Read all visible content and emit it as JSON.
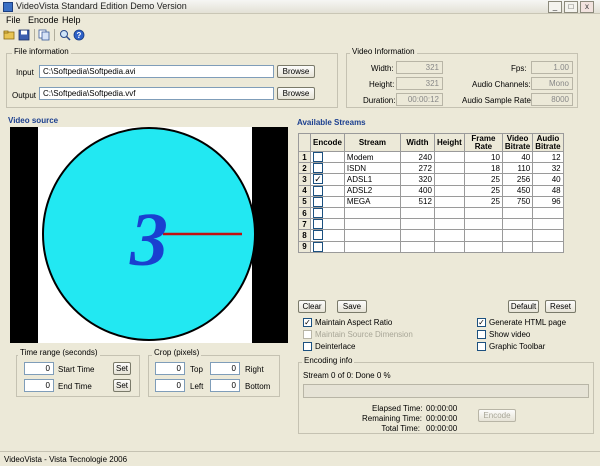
{
  "window": {
    "title": "VideoVista Standard Edition  Demo Version",
    "controls": [
      "_",
      "□",
      "x"
    ]
  },
  "menu": [
    "File",
    "Encode",
    "Help"
  ],
  "toolbar": [
    "open-icon",
    "save-icon",
    "copy-icon",
    "find-icon",
    "help-icon"
  ],
  "file_info": {
    "heading": "File information",
    "input_label": "Input",
    "input_value": "C:\\Softpedia\\Softpedia.avi",
    "output_label": "Output",
    "output_value": "C:\\Softpedia\\Softpedia.vvf",
    "browse_label": "Browse"
  },
  "video_info": {
    "heading": "Video Information",
    "width_label": "Width:",
    "width_value": "321",
    "height_label": "Height:",
    "height_value": "321",
    "duration_label": "Duration:",
    "duration_value": "00:00:12",
    "fps_label": "Fps:",
    "fps_value": "1.00",
    "channels_label": "Audio Channels:",
    "channels_value": "Mono",
    "rate_label": "Audio Sample Rate:",
    "rate_value": "8000"
  },
  "video_source": {
    "heading": "Video source",
    "frame_digit": "3"
  },
  "time_range": {
    "heading": "Time range (seconds)",
    "start_value": "0",
    "start_label": "Start Time",
    "end_value": "0",
    "end_label": "End Time",
    "set_label": "Set"
  },
  "crop": {
    "heading": "Crop (pixels)",
    "top_value": "0",
    "top_label": "Top",
    "right_value": "0",
    "right_label": "Right",
    "left_value": "0",
    "left_label": "Left",
    "bottom_value": "0",
    "bottom_label": "Bottom"
  },
  "streams": {
    "heading": "Available Streams",
    "columns": [
      "Encode",
      "Stream",
      "Width",
      "Height",
      "Frame Rate",
      "Video Bitrate",
      "Audio Bitrate"
    ],
    "rows": [
      {
        "n": "1",
        "encode": "",
        "stream": "Modem",
        "width": "240",
        "height": "",
        "fps": "10",
        "vbr": "40",
        "abr": "12"
      },
      {
        "n": "2",
        "encode": "",
        "stream": "ISDN",
        "width": "272",
        "height": "",
        "fps": "18",
        "vbr": "110",
        "abr": "32"
      },
      {
        "n": "3",
        "encode": "✓",
        "stream": "ADSL1",
        "width": "320",
        "height": "",
        "fps": "25",
        "vbr": "256",
        "abr": "40"
      },
      {
        "n": "4",
        "encode": "",
        "stream": "ADSL2",
        "width": "400",
        "height": "",
        "fps": "25",
        "vbr": "450",
        "abr": "48"
      },
      {
        "n": "5",
        "encode": "",
        "stream": "MEGA",
        "width": "512",
        "height": "",
        "fps": "25",
        "vbr": "750",
        "abr": "96"
      },
      {
        "n": "6",
        "encode": "",
        "stream": "",
        "width": "",
        "height": "",
        "fps": "",
        "vbr": "",
        "abr": ""
      },
      {
        "n": "7",
        "encode": "",
        "stream": "",
        "width": "",
        "height": "",
        "fps": "",
        "vbr": "",
        "abr": ""
      },
      {
        "n": "8",
        "encode": "",
        "stream": "",
        "width": "",
        "height": "",
        "fps": "",
        "vbr": "",
        "abr": ""
      },
      {
        "n": "9",
        "encode": "",
        "stream": "",
        "width": "",
        "height": "",
        "fps": "",
        "vbr": "",
        "abr": ""
      }
    ],
    "clear_label": "Clear",
    "save_label": "Save",
    "default_label": "Default",
    "reset_label": "Reset"
  },
  "options": {
    "maintain_aspect": "Maintain Aspect Ratio",
    "maintain_source": "Maintain Source Dimension",
    "deinterlace": "Deinterlace",
    "generate_html": "Generate HTML page",
    "show_video": "Show video",
    "graphic_toolbar": "Graphic Toolbar"
  },
  "encoding": {
    "heading": "Encoding info",
    "status": "Stream 0 of 0: Done 0 %",
    "elapsed_label": "Elapsed Time:",
    "elapsed_value": "00:00:00",
    "remaining_label": "Remaining Time:",
    "remaining_value": "00:00:00",
    "total_label": "Total Time:",
    "total_value": "00:00:00",
    "encode_label": "Encode"
  },
  "status_bar": "VideoVista - Vista Tecnologie 2006",
  "colors": {
    "clock_face": "#22e8f2",
    "digit": "#1a3fd0",
    "hand": "#c01010",
    "heading_blue": "#1b3f8f"
  }
}
